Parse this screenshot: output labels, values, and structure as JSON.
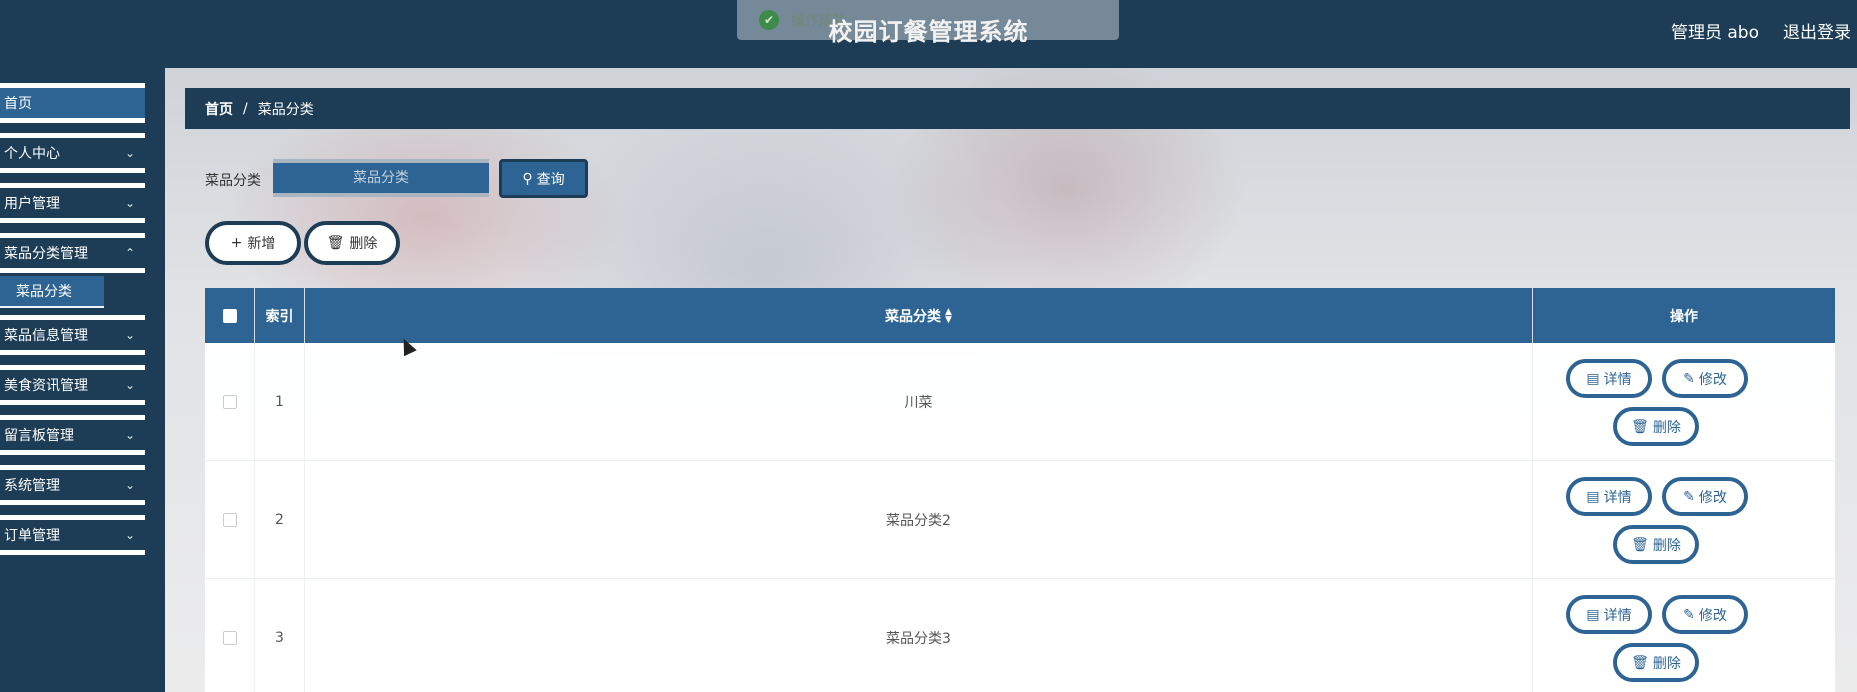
{
  "app": {
    "title": "校园订餐管理系统"
  },
  "toast": {
    "text": "操作成功",
    "icon": "check-circle-icon"
  },
  "header": {
    "user_label": "管理员 abo",
    "logout_label": "退出登录"
  },
  "sidebar": {
    "items": [
      {
        "label": "首页",
        "active": true
      },
      {
        "label": "个人中心"
      },
      {
        "label": "用户管理"
      },
      {
        "label": "菜品分类管理"
      },
      {
        "label": "菜品信息管理"
      },
      {
        "label": "美食资讯管理"
      },
      {
        "label": "留言板管理"
      },
      {
        "label": "系统管理"
      },
      {
        "label": "订单管理"
      }
    ],
    "sub_item": {
      "label": "菜品分类"
    }
  },
  "breadcrumb": {
    "home": "首页",
    "separator": "/",
    "current": "菜品分类"
  },
  "filter": {
    "label": "菜品分类",
    "placeholder": "菜品分类",
    "query_label": "查询"
  },
  "actions": {
    "add_label": "新增",
    "delete_label": "删除"
  },
  "table": {
    "headers": {
      "index": "索引",
      "category": "菜品分类",
      "ops": "操作"
    },
    "rows": [
      {
        "index": "1",
        "category": "川菜"
      },
      {
        "index": "2",
        "category": "菜品分类2"
      },
      {
        "index": "3",
        "category": "菜品分类3"
      }
    ],
    "row_buttons": {
      "detail": "详情",
      "edit": "修改",
      "delete": "删除"
    }
  },
  "colors": {
    "header_bg": "#1d3c55",
    "accent": "#2e6494"
  }
}
